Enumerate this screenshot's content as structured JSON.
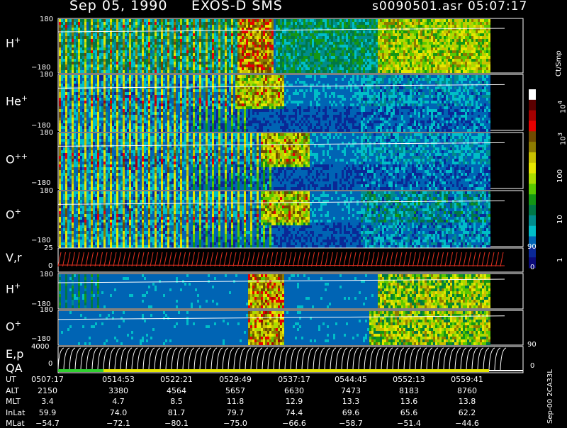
{
  "header": {
    "date": "Sep 05, 1990",
    "instrument": "EXOS-D SMS",
    "file": "s0090501.asr",
    "time": "05:07:17"
  },
  "colorbar": {
    "title": "Ct/Smp",
    "ticks": [
      "10",
      "10",
      "100",
      "10",
      "1"
    ],
    "exponents": [
      "4",
      "3",
      "",
      "",
      ""
    ],
    "colors": [
      "#ffffff",
      "#5a0000",
      "#a50000",
      "#e60000",
      "#6f4a00",
      "#8c7a00",
      "#c8c000",
      "#e6e600",
      "#aadc00",
      "#5ac800",
      "#149614",
      "#007846",
      "#008c8c",
      "#00bec8",
      "#0064b4",
      "#0a2896",
      "#0a0a78"
    ]
  },
  "footer_label": "Sep-00 2CA33L",
  "time_rows": {
    "labels": [
      "UT",
      "ALT",
      "MLT",
      "InLat",
      "MLat"
    ],
    "columns": [
      [
        "0507:17",
        "2150",
        "3.4",
        "59.9",
        "−54.7"
      ],
      [
        "0514:53",
        "3380",
        "4.7",
        "74.0",
        "−72.1"
      ],
      [
        "0522:21",
        "4564",
        "8.5",
        "81.7",
        "−80.1"
      ],
      [
        "0529:49",
        "5657",
        "11.8",
        "79.7",
        "−75.0"
      ],
      [
        "0537:17",
        "6630",
        "12.9",
        "74.4",
        "−66.6"
      ],
      [
        "0544:45",
        "7473",
        "13.3",
        "69.6",
        "−58.7"
      ],
      [
        "0552:13",
        "8183",
        "13.6",
        "65.6",
        "−51.4"
      ],
      [
        "0559:41",
        "8760",
        "13.8",
        "62.2",
        "−44.6"
      ]
    ]
  },
  "chart_data": [
    {
      "type": "heatmap",
      "row_label": "H",
      "superscript": "+",
      "ylim": [
        -180,
        180
      ],
      "ytick_top": "180",
      "ytick_bottom": "−180",
      "colorscale": "log",
      "zlim": [
        1,
        10000
      ],
      "zunit": "Ct/Smp"
    },
    {
      "type": "heatmap",
      "row_label": "He",
      "superscript": "+",
      "ylim": [
        -180,
        180
      ],
      "ytick_top": "180",
      "ytick_bottom": "−180",
      "colorscale": "log",
      "zlim": [
        1,
        10000
      ],
      "zunit": "Ct/Smp"
    },
    {
      "type": "heatmap",
      "row_label": "O",
      "superscript": "++",
      "ylim": [
        -180,
        180
      ],
      "ytick_top": "180",
      "ytick_bottom": "−180",
      "colorscale": "log",
      "zlim": [
        1,
        10000
      ],
      "zunit": "Ct/Smp"
    },
    {
      "type": "heatmap",
      "row_label": "O",
      "superscript": "+",
      "ylim": [
        -180,
        180
      ],
      "ytick_top": "180",
      "ytick_bottom": "−180",
      "colorscale": "log",
      "zlim": [
        1,
        10000
      ],
      "zunit": "Ct/Smp"
    },
    {
      "type": "line",
      "row_label": "V,r",
      "superscript": "",
      "ylim": [
        0,
        25
      ],
      "ytick_top": "25",
      "ytick_bottom": "0",
      "y2_ticks": [
        "90",
        "0"
      ],
      "line_color": "#e03020"
    },
    {
      "type": "heatmap",
      "row_label": "H",
      "superscript": "+",
      "ylim": [
        -180,
        180
      ],
      "ytick_top": "180",
      "ytick_bottom": "−180",
      "colorscale": "log",
      "zlim": [
        1,
        10000
      ],
      "zunit": "Ct/Smp"
    },
    {
      "type": "heatmap",
      "row_label": "O",
      "superscript": "+",
      "ylim": [
        -180,
        180
      ],
      "ytick_top": "180",
      "ytick_bottom": "−180",
      "colorscale": "log",
      "zlim": [
        1,
        10000
      ],
      "zunit": "Ct/Smp"
    },
    {
      "type": "line",
      "row_label": "E,p",
      "row_label2": "QA",
      "superscript": "",
      "ylim": [
        0,
        4000
      ],
      "ytick_top": "4000",
      "ytick_bottom": "0",
      "y2_ticks": [
        "90",
        "0"
      ],
      "line_color": "#ffffff",
      "qa_colors": [
        "#30d030",
        "#e6e600",
        "#ffffff"
      ]
    }
  ]
}
